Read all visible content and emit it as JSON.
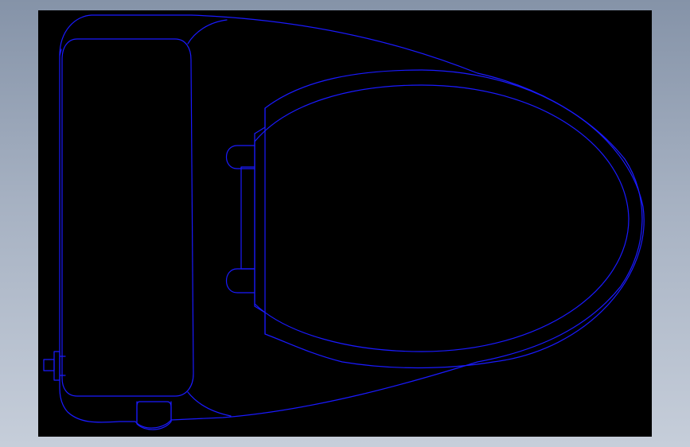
{
  "colors": {
    "model_space_background": "#000000",
    "line_color": "#1a1aff",
    "window_background_top": "#8593a8",
    "window_background_bottom": "#c6ceda"
  }
}
